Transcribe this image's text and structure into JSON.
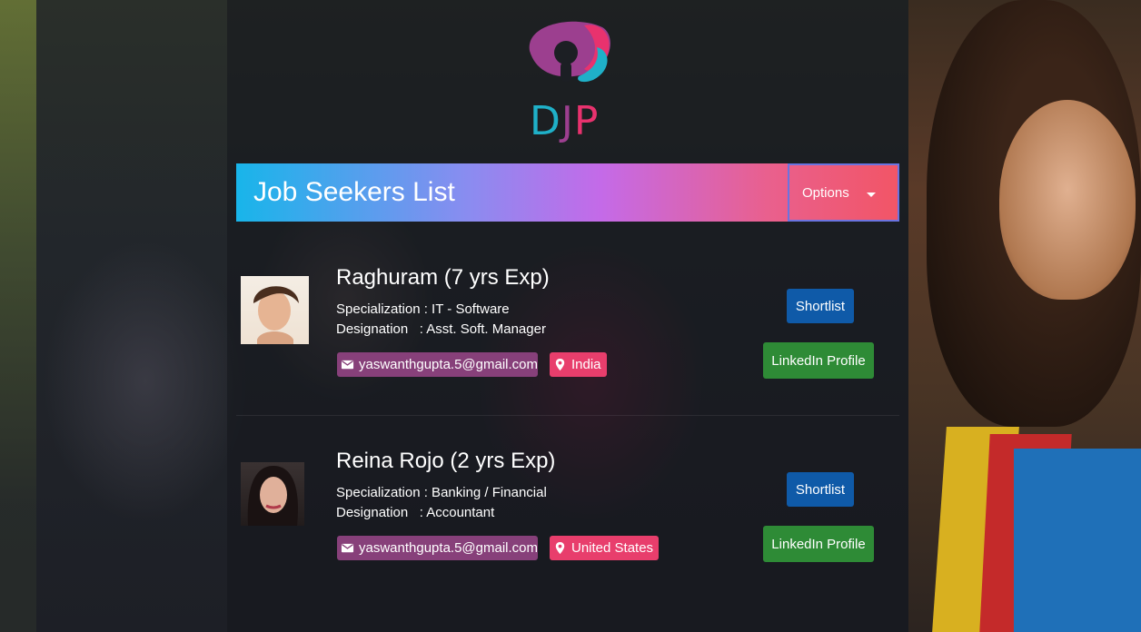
{
  "brand": {
    "logo_letters": [
      "D",
      "J",
      "P"
    ],
    "colors": {
      "d": "#1fb0c8",
      "j": "#9c3f8f",
      "p": "#e8326e"
    }
  },
  "header": {
    "title": "Job Seekers List",
    "options_label": "Options"
  },
  "seekers": [
    {
      "name": "Raghuram (7 yrs Exp)",
      "specialization": "Specialization : IT - Software",
      "designation": "Designation   : Asst. Soft. Manager",
      "email": "yaswanthgupta.5@gmail.com",
      "location": "India",
      "shortlist_label": "Shortlist",
      "linkedin_label": "LinkedIn Profile"
    },
    {
      "name": "Reina Rojo (2 yrs Exp)",
      "specialization": "Specialization : Banking / Financial",
      "designation": "Designation   : Accountant",
      "email": "yaswanthgupta.5@gmail.com",
      "location": "United States",
      "shortlist_label": "Shortlist",
      "linkedin_label": "LinkedIn Profile"
    }
  ],
  "icons": {
    "email": "mail-icon",
    "location": "map-pin-icon",
    "options_caret": "caret-down-icon"
  },
  "colors": {
    "shortlist_button": "#0f5aa8",
    "linkedin_button": "#2e8b36",
    "email_chip": "#87407a",
    "location_chip": "#e83e6c"
  }
}
